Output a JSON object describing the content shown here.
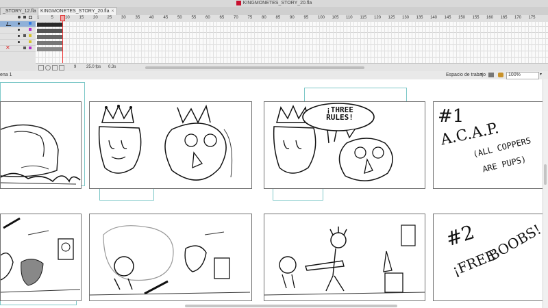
{
  "window": {
    "title": "KINGMONETES_STORY_20.fla"
  },
  "tabs": [
    {
      "label": "_STORY_12.fla",
      "close": "×"
    },
    {
      "label": "KINGMONETES_STORY_20.fla",
      "close": "×"
    }
  ],
  "timeline": {
    "frame_numbers": [
      "1",
      "5",
      "10",
      "15",
      "20",
      "25",
      "30",
      "35",
      "40",
      "45",
      "50",
      "55",
      "60",
      "65",
      "70",
      "75",
      "80",
      "85",
      "90",
      "95",
      "100",
      "105",
      "110",
      "115",
      "120",
      "125",
      "130",
      "135",
      "140",
      "145",
      "150",
      "155",
      "160",
      "165",
      "170",
      "175"
    ],
    "current_frame": "9",
    "fps": "25.0 fps",
    "elapsed": "0.3s"
  },
  "editbar": {
    "scene": "ena 1",
    "workspace": "Espacio de trabajo",
    "zoom": "100%"
  },
  "stage": {
    "panel2_bubble": "¡THREE RULES!",
    "panel4_lines": [
      "#1",
      "A.C.A.P.",
      "(ALL COPPERS",
      "ARE PUPS)"
    ],
    "panel8_lines": [
      "#2",
      "¡FREE",
      "BOOBS!"
    ]
  },
  "colors": {
    "guide": "#7dc8c8",
    "playhead": "#e33333",
    "selected_layer": "#8fb0d8"
  }
}
